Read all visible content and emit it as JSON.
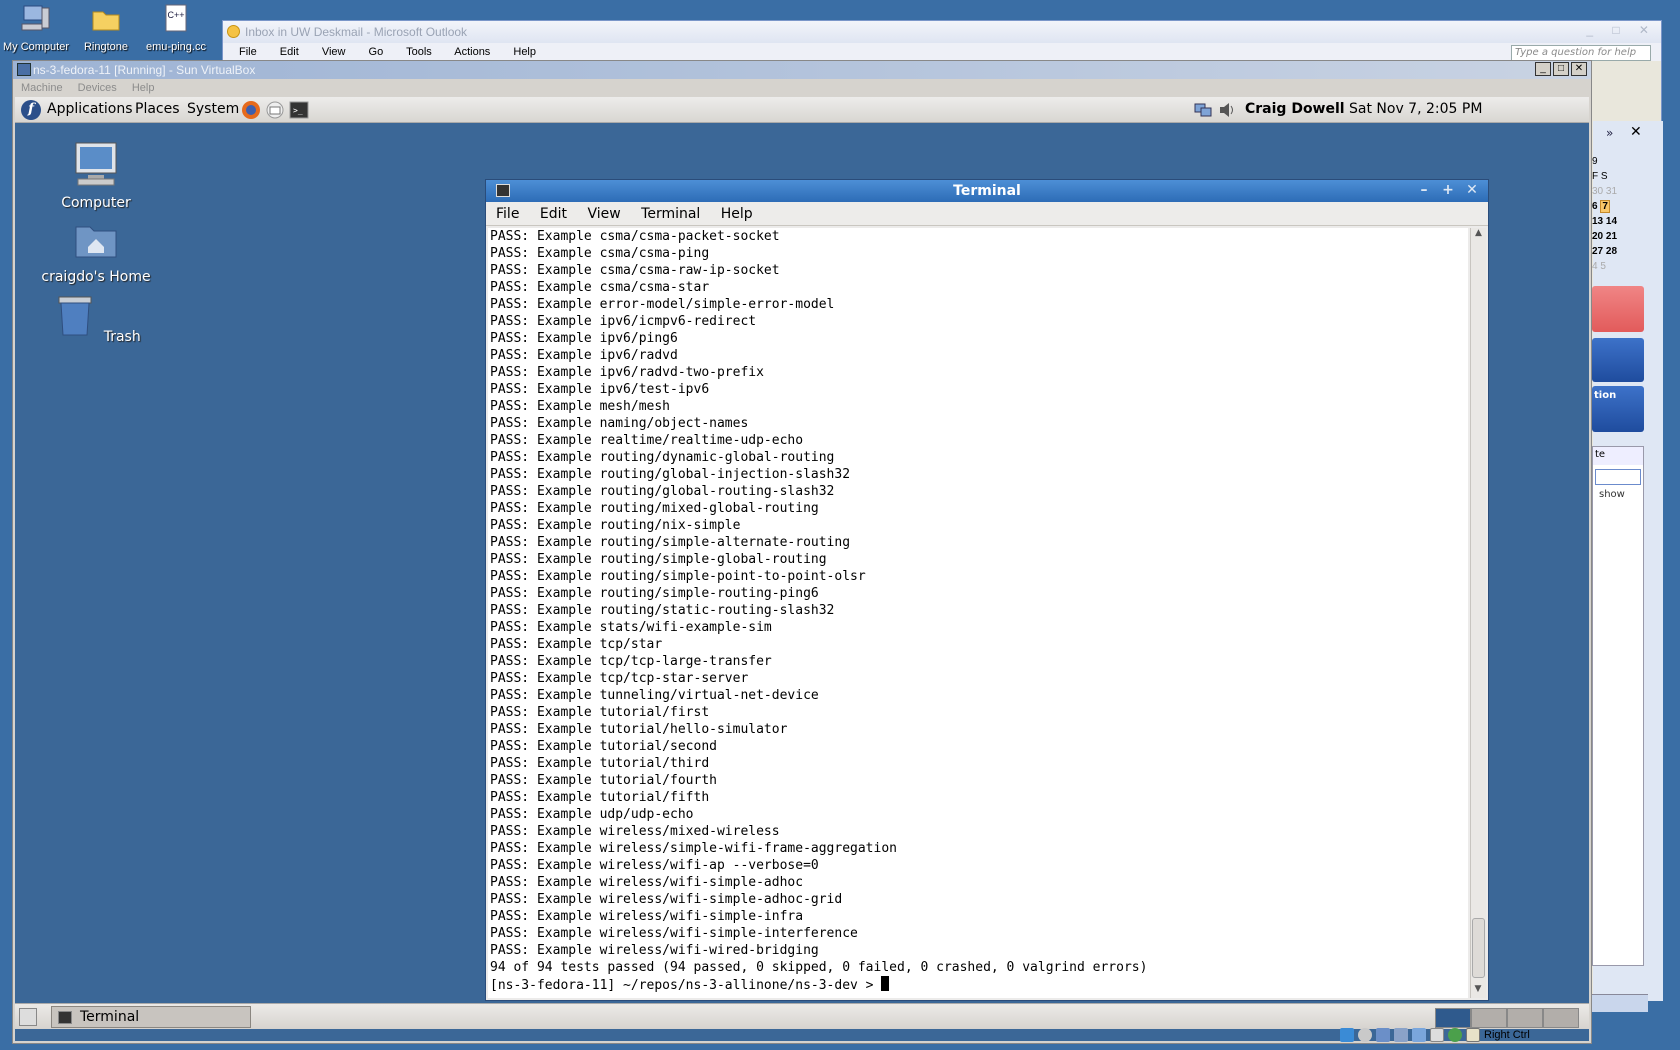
{
  "host_desktop": {
    "icons": [
      {
        "label": "My Computer"
      },
      {
        "label": "Ringtone"
      },
      {
        "label": "emu-ping.cc"
      }
    ]
  },
  "outlook": {
    "title": "Inbox in UW Deskmail - Microsoft Outlook",
    "menu": [
      "File",
      "Edit",
      "View",
      "Go",
      "Tools",
      "Actions",
      "Help"
    ],
    "ask_placeholder": "Type a question for help",
    "calendar": {
      "header_num": "9",
      "weekdays": "F S",
      "rows": [
        [
          "30",
          "31"
        ],
        [
          "6",
          "7"
        ],
        [
          "13",
          "14"
        ],
        [
          "20",
          "21"
        ],
        [
          "27",
          "28"
        ],
        [
          "4",
          "5"
        ]
      ]
    },
    "card_text": "tion",
    "panel_header": "te",
    "show_label": "show"
  },
  "vbox": {
    "title": "ns-3-fedora-11 [Running] - Sun VirtualBox",
    "menu": [
      "Machine",
      "Devices",
      "Help"
    ],
    "status_label": "Right Ctrl"
  },
  "gnome": {
    "menus": [
      "Applications",
      "Places",
      "System"
    ],
    "user": "Craig Dowell",
    "clock": "Sat Nov  7,  2:05 PM",
    "desktop_icons": [
      {
        "label": "Computer"
      },
      {
        "label": "craigdo's Home"
      },
      {
        "label": "Trash"
      }
    ],
    "taskbar_item": "Terminal"
  },
  "terminal": {
    "title": "Terminal",
    "menu": [
      "File",
      "Edit",
      "View",
      "Terminal",
      "Help"
    ],
    "lines": [
      "PASS: Example csma/csma-packet-socket",
      "PASS: Example csma/csma-ping",
      "PASS: Example csma/csma-raw-ip-socket",
      "PASS: Example csma/csma-star",
      "PASS: Example error-model/simple-error-model",
      "PASS: Example ipv6/icmpv6-redirect",
      "PASS: Example ipv6/ping6",
      "PASS: Example ipv6/radvd",
      "PASS: Example ipv6/radvd-two-prefix",
      "PASS: Example ipv6/test-ipv6",
      "PASS: Example mesh/mesh",
      "PASS: Example naming/object-names",
      "PASS: Example realtime/realtime-udp-echo",
      "PASS: Example routing/dynamic-global-routing",
      "PASS: Example routing/global-injection-slash32",
      "PASS: Example routing/global-routing-slash32",
      "PASS: Example routing/mixed-global-routing",
      "PASS: Example routing/nix-simple",
      "PASS: Example routing/simple-alternate-routing",
      "PASS: Example routing/simple-global-routing",
      "PASS: Example routing/simple-point-to-point-olsr",
      "PASS: Example routing/simple-routing-ping6",
      "PASS: Example routing/static-routing-slash32",
      "PASS: Example stats/wifi-example-sim",
      "PASS: Example tcp/star",
      "PASS: Example tcp/tcp-large-transfer",
      "PASS: Example tcp/tcp-star-server",
      "PASS: Example tunneling/virtual-net-device",
      "PASS: Example tutorial/first",
      "PASS: Example tutorial/hello-simulator",
      "PASS: Example tutorial/second",
      "PASS: Example tutorial/third",
      "PASS: Example tutorial/fourth",
      "PASS: Example tutorial/fifth",
      "PASS: Example udp/udp-echo",
      "PASS: Example wireless/mixed-wireless",
      "PASS: Example wireless/simple-wifi-frame-aggregation",
      "PASS: Example wireless/wifi-ap --verbose=0",
      "PASS: Example wireless/wifi-simple-adhoc",
      "PASS: Example wireless/wifi-simple-adhoc-grid",
      "PASS: Example wireless/wifi-simple-infra",
      "PASS: Example wireless/wifi-simple-interference",
      "PASS: Example wireless/wifi-wired-bridging",
      "94 of 94 tests passed (94 passed, 0 skipped, 0 failed, 0 crashed, 0 valgrind errors)"
    ],
    "prompt": "[ns-3-fedora-11] ~/repos/ns-3-allinone/ns-3-dev > "
  }
}
